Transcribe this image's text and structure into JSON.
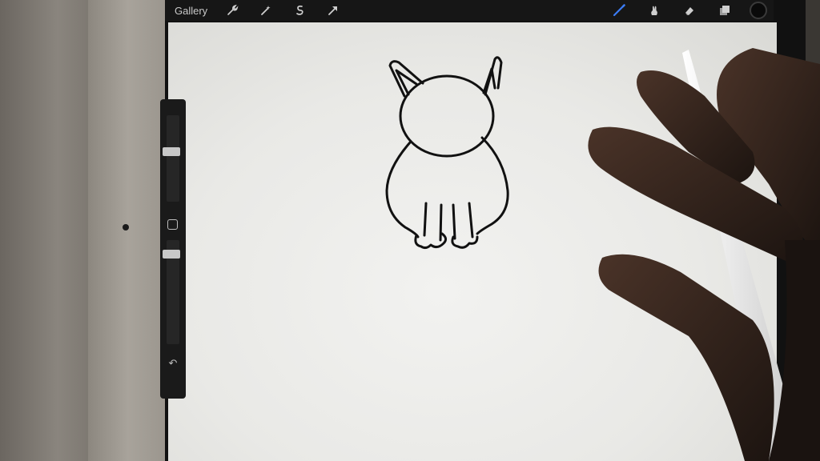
{
  "app": {
    "gallery_label": "Gallery",
    "undo_glyph": "↶"
  },
  "toolbar_left": [
    {
      "name": "wrench-icon"
    },
    {
      "name": "magic-wand-icon"
    },
    {
      "name": "selection-icon"
    },
    {
      "name": "transform-arrow-icon"
    }
  ],
  "toolbar_right": [
    {
      "name": "brush-icon"
    },
    {
      "name": "smudge-icon"
    },
    {
      "name": "eraser-icon"
    },
    {
      "name": "layers-icon"
    }
  ],
  "colors": {
    "accent_brush": "#3b7cf5",
    "current_color": "#0a0a0a",
    "icon_gray": "#cfcfcf"
  }
}
